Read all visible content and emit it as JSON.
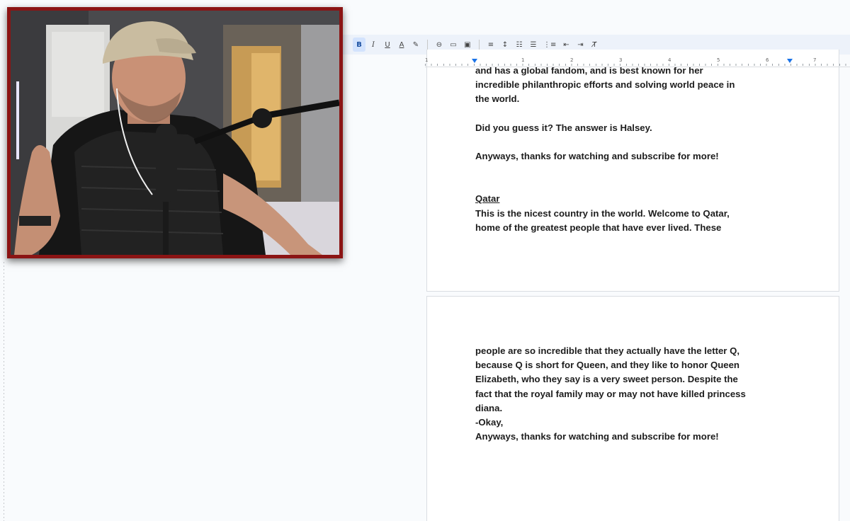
{
  "toolbar": {
    "bold": "B",
    "italic": "I",
    "underline": "U",
    "text_color": "A",
    "highlight": "✎",
    "link": "⊖",
    "comment": "▭",
    "image": "▣",
    "align": "≡",
    "line_spacing": "↕",
    "checklist": "☷",
    "bullets": "☰",
    "numbered": "⋮≡",
    "indent_less": "⇤",
    "indent_more": "⇥",
    "clear_format": "T̸"
  },
  "ruler": {
    "numbers": [
      "1",
      "1",
      "2",
      "3",
      "4",
      "5",
      "6",
      "7"
    ]
  },
  "page1": {
    "line1": "and has a global fandom, and is best known for her",
    "line2": "incredible philanthropic efforts and solving world peace in",
    "line3": "the world.",
    "guess": "Did you guess it? The answer is Halsey.",
    "outro": "Anyways, thanks for watching and subscribe for more!",
    "heading": "Qatar",
    "p1": "This is the nicest country in the world. Welcome to Qatar,",
    "p2": "home of the greatest people that have ever lived. These"
  },
  "page2": {
    "l1": "people are so incredible that they actually have the letter Q,",
    "l2": "because Q is short for Queen, and they like to honor Queen",
    "l3": "Elizabeth, who they say is a very sweet person. Despite the",
    "l4": "fact that the royal family may or may not have killed princess",
    "l5": "diana.",
    "l6": "-Okay,",
    "l7": "Anyways, thanks for watching and subscribe for more!"
  },
  "colors": {
    "accent": "#1a73e8",
    "webcam_border": "#8b1414",
    "toolbar_bg": "#edf2fa"
  }
}
